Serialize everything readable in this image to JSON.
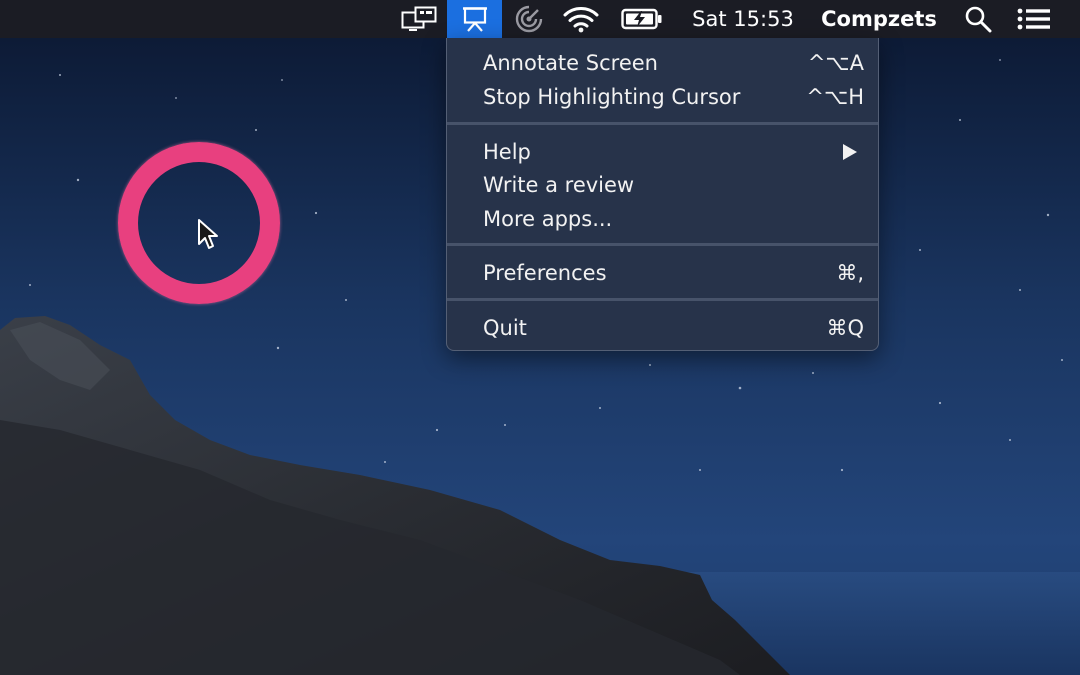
{
  "menubar": {
    "items": [
      {
        "name": "display-mirror-icon"
      },
      {
        "name": "presentation-board-icon",
        "active": true
      },
      {
        "name": "radar-icon"
      },
      {
        "name": "wifi-icon"
      },
      {
        "name": "battery-charging-icon"
      }
    ],
    "clock": "Sat 15:53",
    "user": "Compzets",
    "search_icon": "search-icon",
    "list_icon": "notification-center-icon"
  },
  "menu": {
    "items": [
      {
        "label": "Annotate Screen",
        "shortcut": "^⌥A"
      },
      {
        "label": "Stop Highlighting Cursor",
        "shortcut": "^⌥H"
      },
      {
        "label": "Help",
        "submenu_icon": "chevron-right-icon"
      },
      {
        "label": "Write a review"
      },
      {
        "label": "More apps..."
      },
      {
        "label": "Preferences",
        "shortcut": "⌘,"
      },
      {
        "label": "Quit",
        "shortcut": "⌘Q"
      }
    ]
  },
  "colors": {
    "menubar_bg": "#1b1c24",
    "active_icon_bg": "#1b6fe0",
    "menu_bg": "#27334a",
    "highlight_ring": "#e8407f"
  }
}
